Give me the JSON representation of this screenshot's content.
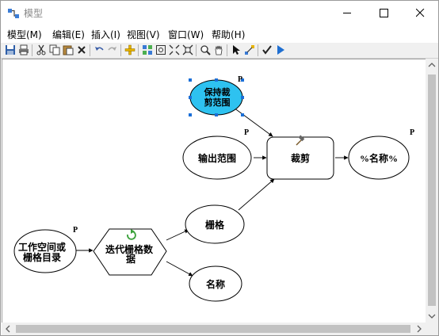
{
  "window": {
    "title": "模型"
  },
  "menu": [
    "模型(M)",
    "编辑(E)",
    "插入(I)",
    "视图(V)",
    "窗口(W)",
    "帮助(H)"
  ],
  "toolbar": {
    "buttons": [
      "save-icon",
      "print-icon",
      "cut-icon",
      "copy-icon",
      "paste-icon",
      "delete-icon",
      "undo-icon",
      "redo-icon",
      "add-data-icon",
      "auto-layout-icon",
      "full-extent-icon",
      "zoom-in-fixed-icon",
      "zoom-out-fixed-icon",
      "zoom-icon",
      "pan-icon",
      "select-icon",
      "connect-icon",
      "validate-icon",
      "run-icon"
    ]
  },
  "model": {
    "nodes": {
      "keep_clip": {
        "line1": "保持裁",
        "line2": "剪范围",
        "p": "P",
        "selected": true,
        "fill": "#2ec2f0"
      },
      "output_extent": {
        "label": "输出范围",
        "p": "P"
      },
      "clip_tool": {
        "label": "裁剪"
      },
      "output_name": {
        "label": "%名称%",
        "p": "P"
      },
      "workspace": {
        "line1": "工作空间或",
        "line2": "栅格目录",
        "p": "P"
      },
      "iterator": {
        "line1": "迭代栅格数",
        "line2": "据"
      },
      "raster": {
        "label": "栅格"
      },
      "name": {
        "label": "名称"
      }
    }
  }
}
